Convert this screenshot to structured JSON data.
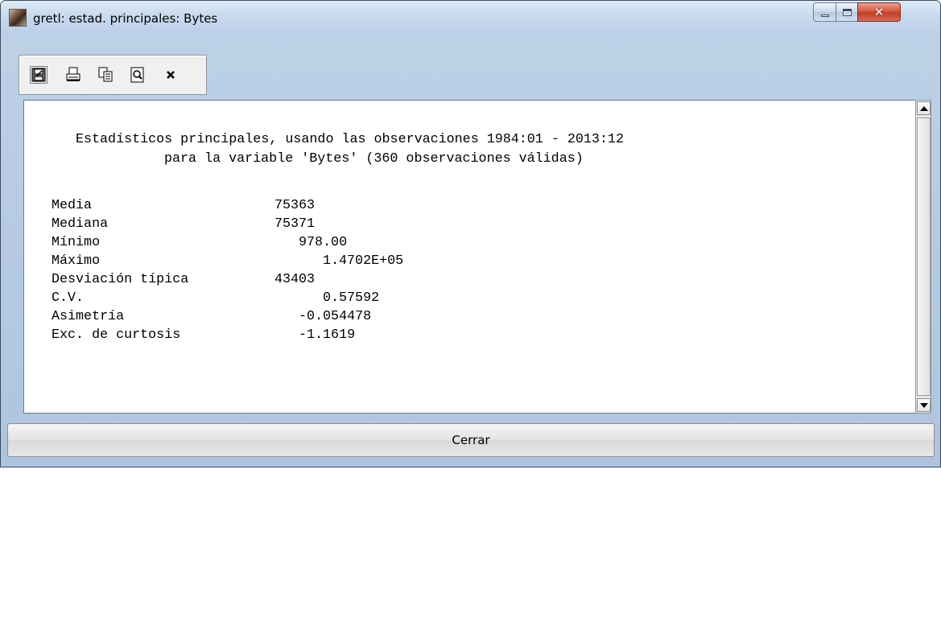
{
  "window": {
    "title": "gretl: estad. principales: Bytes"
  },
  "toolbar": {
    "items": [
      {
        "icon": "save-icon"
      },
      {
        "icon": "print-icon"
      },
      {
        "icon": "copy-icon"
      },
      {
        "icon": "find-icon"
      },
      {
        "icon": "close-icon"
      }
    ]
  },
  "report": {
    "header_line1": "Estadísticos principales, usando las observaciones 1984:01 - 2013:12",
    "header_line2": "para la variable 'Bytes' (360 observaciones válidas)",
    "rows": [
      {
        "label": "Media",
        "value": "75363"
      },
      {
        "label": "Mediana",
        "value": "75371"
      },
      {
        "label": "Mínimo",
        "value": "978.00"
      },
      {
        "label": "Máximo",
        "value": "1.4702E+05"
      },
      {
        "label": "Desviación típica",
        "value": "43403"
      },
      {
        "label": "C.V.",
        "value": "0.57592"
      },
      {
        "label": "Asimetría",
        "value": "-0.054478"
      },
      {
        "label": "Exc. de curtosis",
        "value": "-1.1619"
      }
    ]
  },
  "footer": {
    "close_label": "Cerrar"
  },
  "colors": {
    "close_button_red": "#c33d25",
    "frame_blue": "#bdd1e7"
  }
}
